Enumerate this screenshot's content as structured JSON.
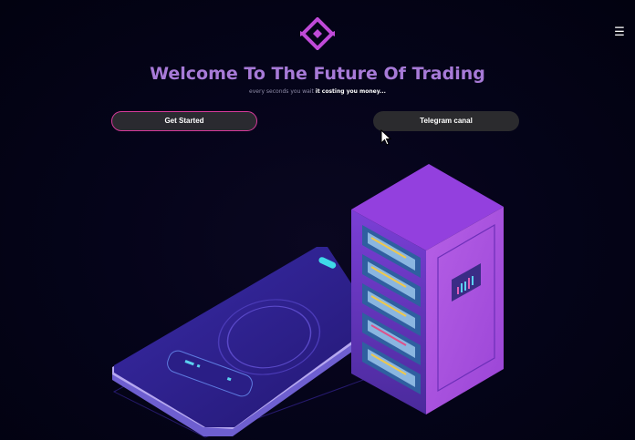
{
  "header": {
    "logo_icon": "diamond-logo-icon",
    "menu_icon": "hamburger-menu-icon",
    "menu_glyph": "☰"
  },
  "hero": {
    "title": "Welcome To The Future Of Trading",
    "subtitle_prefix": "every seconds you wait ",
    "subtitle_strong": "it costing you money..."
  },
  "actions": {
    "get_started_label": "Get Started",
    "telegram_label": "Telegram canal"
  },
  "colors": {
    "title": "#a77ad7",
    "accent_border": "#d63a9a",
    "button_bg": "#2a2a30",
    "logo": "#c04ad8",
    "server": "#a24de0",
    "tablet": "#2c1f86"
  },
  "illustration": {
    "name": "server-and-tablet-illustration"
  }
}
